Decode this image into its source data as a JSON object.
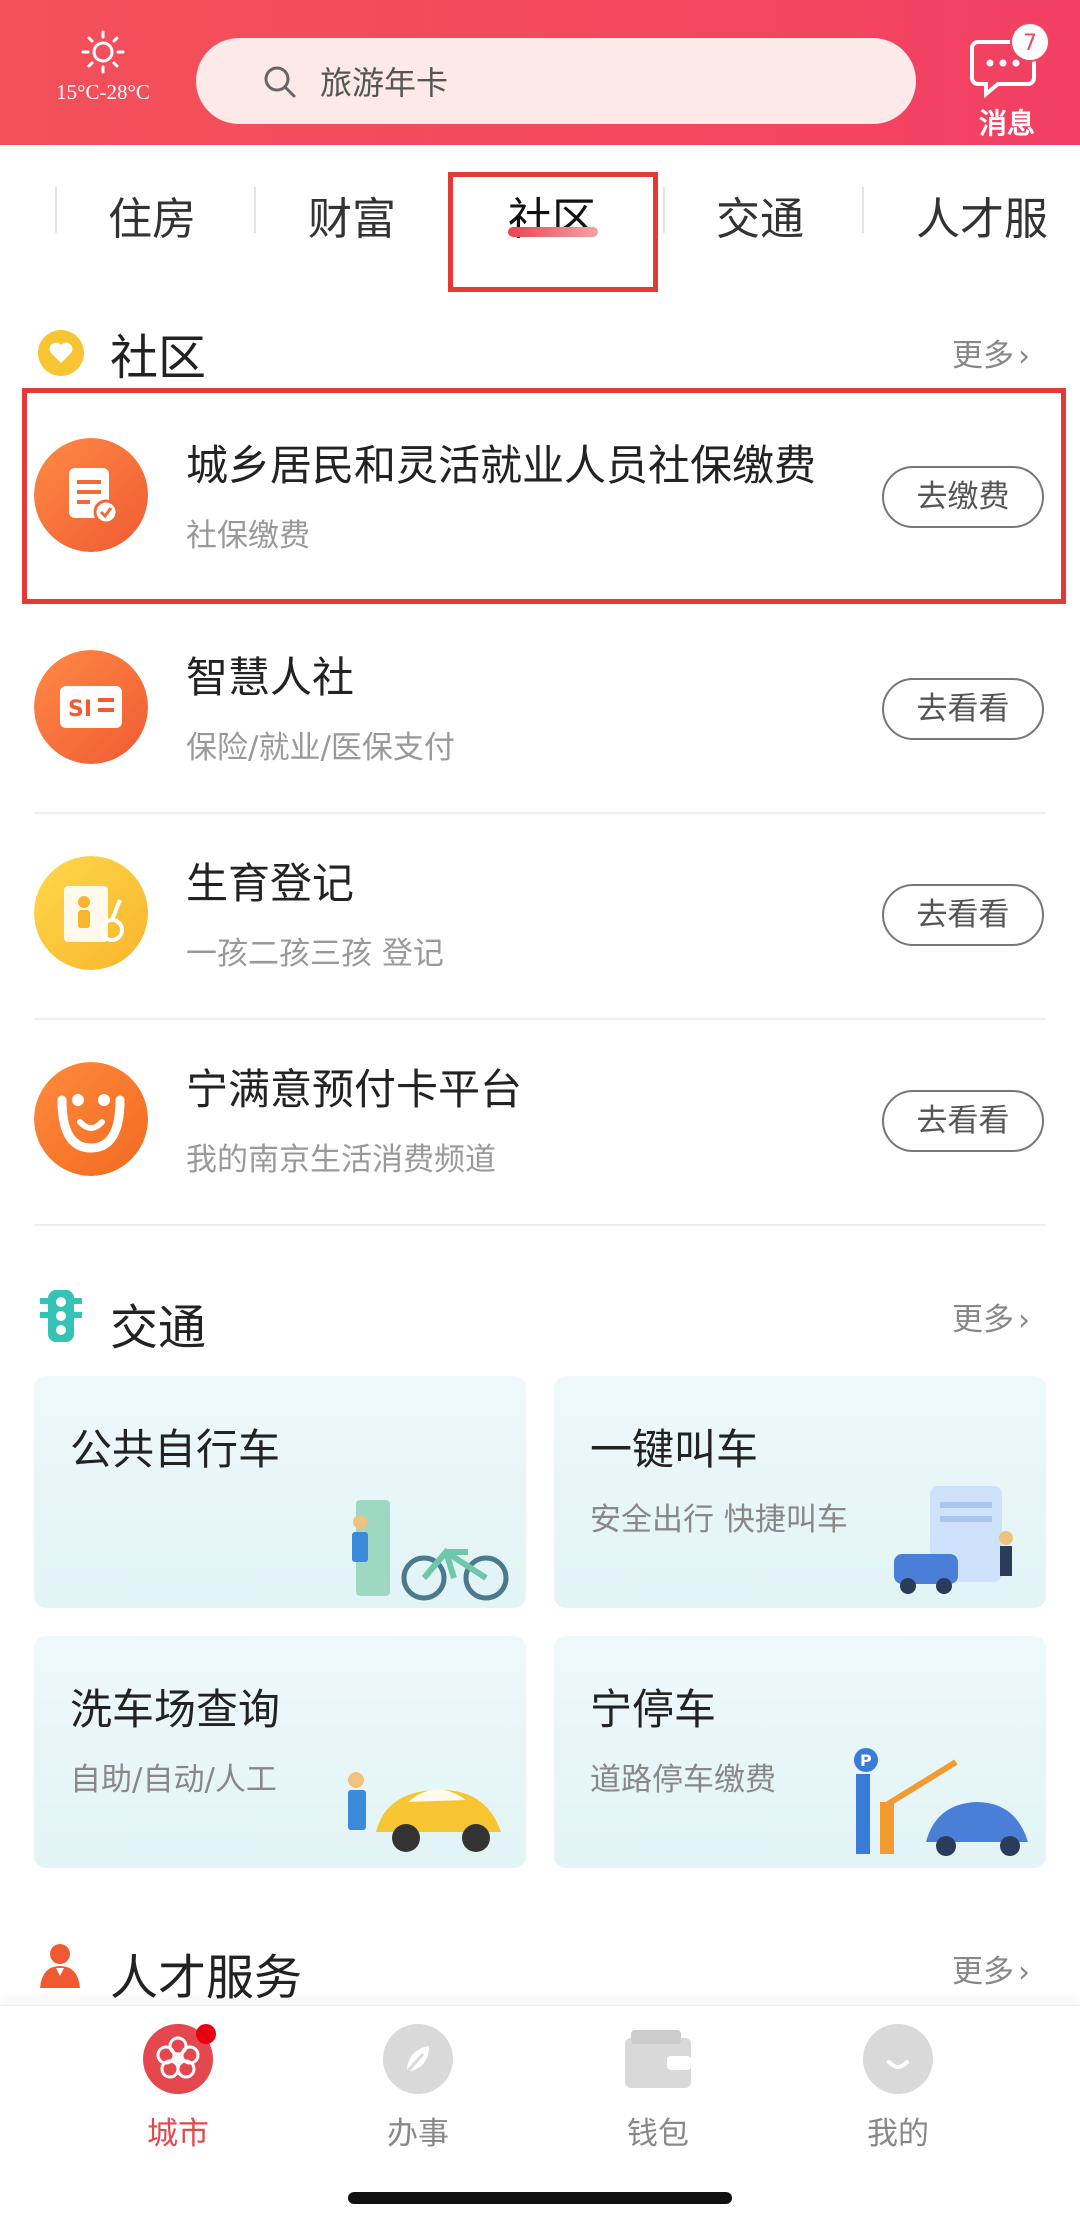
{
  "header": {
    "weather_temp": "15°C-28°C",
    "search_placeholder": "旅游年卡",
    "message_badge": "7",
    "message_label": "消息"
  },
  "tabs": [
    {
      "label": "住房"
    },
    {
      "label": "财富"
    },
    {
      "label": "社区",
      "active": true
    },
    {
      "label": "交通"
    },
    {
      "label": "人才服"
    }
  ],
  "community": {
    "title": "社区",
    "more": "更多",
    "items": [
      {
        "title": "城乡居民和灵活就业人员社保缴费",
        "sub": "社保缴费",
        "button": "去缴费",
        "icon": "bill-icon"
      },
      {
        "title": "智慧人社",
        "sub": "保险/就业/医保支付",
        "button": "去看看",
        "icon": "si-card-icon"
      },
      {
        "title": "生育登记",
        "sub": "一孩二孩三孩 登记",
        "button": "去看看",
        "icon": "birth-registration-icon"
      },
      {
        "title": "宁满意预付卡平台",
        "sub": "我的南京生活消费频道",
        "button": "去看看",
        "icon": "smile-face-icon"
      }
    ]
  },
  "traffic": {
    "title": "交通",
    "more": "更多",
    "cards": [
      {
        "title": "公共自行车",
        "sub": ""
      },
      {
        "title": "一键叫车",
        "sub": "安全出行 快捷叫车"
      },
      {
        "title": "洗车场查询",
        "sub": "自助/自动/人工"
      },
      {
        "title": "宁停车",
        "sub": "道路停车缴费"
      }
    ]
  },
  "talent": {
    "title": "人才服务",
    "more": "更多"
  },
  "bottom_nav": [
    {
      "label": "城市",
      "active": true
    },
    {
      "label": "办事"
    },
    {
      "label": "钱包"
    },
    {
      "label": "我的"
    }
  ],
  "colors": {
    "header_red": "#f3505a",
    "accent_red": "#e5474e",
    "highlight_box": "#e53935"
  }
}
